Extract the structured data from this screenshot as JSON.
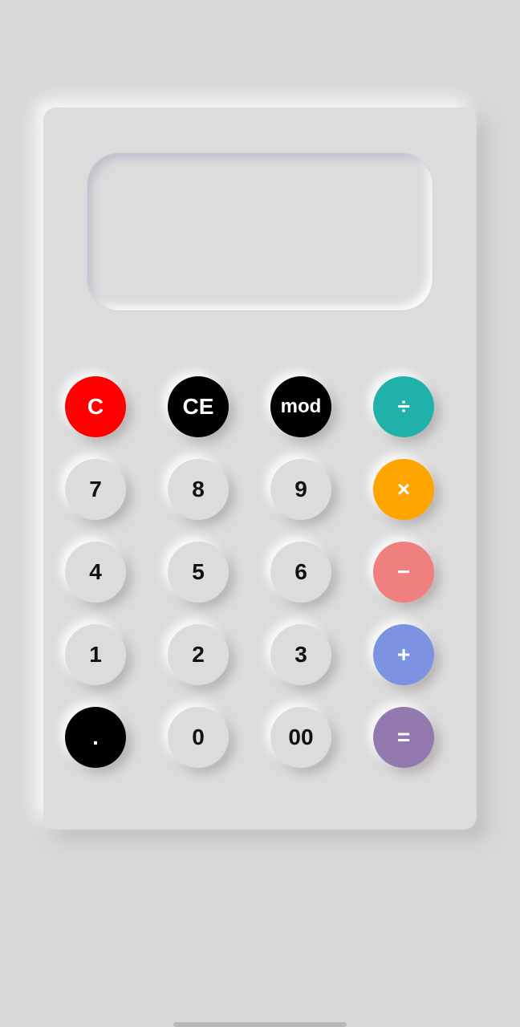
{
  "display": {
    "value": ""
  },
  "keys": [
    {
      "id": "clear",
      "label": "C",
      "color": "#ff0000",
      "text_color": "#ffffff"
    },
    {
      "id": "clear-entry",
      "label": "CE",
      "color": "#000000",
      "text_color": "#ffffff"
    },
    {
      "id": "mod",
      "label": "mod",
      "color": "#000000",
      "text_color": "#ffffff"
    },
    {
      "id": "divide",
      "label": "÷",
      "color": "#20b2aa",
      "text_color": "#ffffff"
    },
    {
      "id": "seven",
      "label": "7",
      "color": "#dcdcdc",
      "text_color": "#111111"
    },
    {
      "id": "eight",
      "label": "8",
      "color": "#dcdcdc",
      "text_color": "#111111"
    },
    {
      "id": "nine",
      "label": "9",
      "color": "#dcdcdc",
      "text_color": "#111111"
    },
    {
      "id": "multiply",
      "label": "×",
      "color": "#ffa500",
      "text_color": "#ffffff"
    },
    {
      "id": "four",
      "label": "4",
      "color": "#dcdcdc",
      "text_color": "#111111"
    },
    {
      "id": "five",
      "label": "5",
      "color": "#dcdcdc",
      "text_color": "#111111"
    },
    {
      "id": "six",
      "label": "6",
      "color": "#dcdcdc",
      "text_color": "#111111"
    },
    {
      "id": "minus",
      "label": "−",
      "color": "#f08080",
      "text_color": "#ffffff"
    },
    {
      "id": "one",
      "label": "1",
      "color": "#dcdcdc",
      "text_color": "#111111"
    },
    {
      "id": "two",
      "label": "2",
      "color": "#dcdcdc",
      "text_color": "#111111"
    },
    {
      "id": "three",
      "label": "3",
      "color": "#dcdcdc",
      "text_color": "#111111"
    },
    {
      "id": "plus",
      "label": "+",
      "color": "#7b93e0",
      "text_color": "#ffffff"
    },
    {
      "id": "decimal",
      "label": ".",
      "color": "#000000",
      "text_color": "#ffffff"
    },
    {
      "id": "zero",
      "label": "0",
      "color": "#dcdcdc",
      "text_color": "#111111"
    },
    {
      "id": "double-zero",
      "label": "00",
      "color": "#dcdcdc",
      "text_color": "#111111"
    },
    {
      "id": "equals",
      "label": "=",
      "color": "#9479b0",
      "text_color": "#ffffff"
    }
  ]
}
